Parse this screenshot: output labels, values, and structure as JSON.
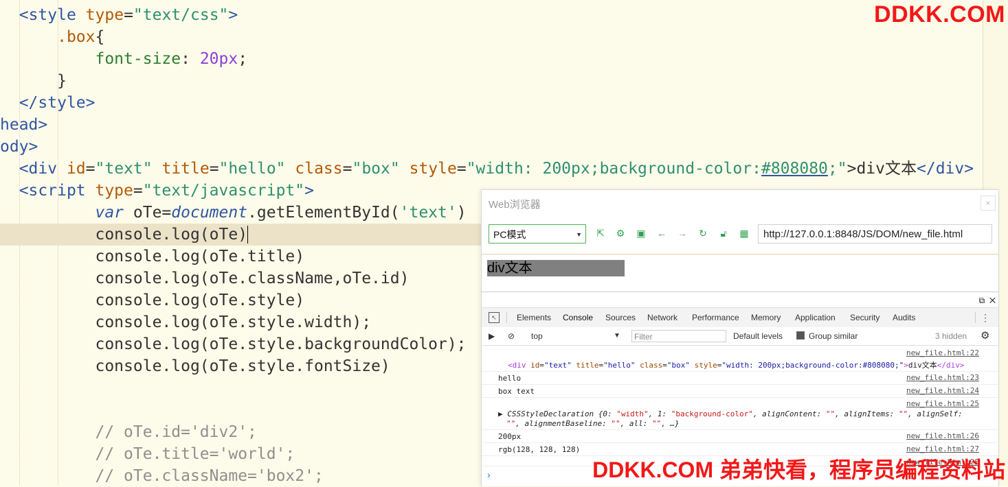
{
  "watermarks": {
    "top": "DDKK.COM",
    "bottom": "DDKK.COM 弟弟快看，程序员编程资料站"
  },
  "code": {
    "l1": {
      "lt": "<",
      "tag": "style",
      "sp": " ",
      "attr": "type",
      "eq": "=",
      "val": "\"text/css\"",
      "gt": ">"
    },
    "l2": {
      "sel": ".box",
      "brace": "{"
    },
    "l3": {
      "prop": "font-size",
      "colon": ": ",
      "num": "20px",
      "semi": ";"
    },
    "l4": {
      "brace": "}"
    },
    "l5": {
      "text": "</style>"
    },
    "l6": {
      "text": "head>"
    },
    "l7": {
      "text": "ody>"
    },
    "l8": {
      "open": "<div ",
      "a1": "id",
      "v1": "\"text\"",
      "a2": "title",
      "v2": "\"hello\"",
      "a3": "class",
      "v3": "\"box\"",
      "a4": "style",
      "v4a": "\"width: 200px;background-color:",
      "v4b": "#808080",
      "v4c": ";\"",
      "content": ">div文本",
      "close": "</div>"
    },
    "l9": {
      "open": "<script ",
      "attr": "type",
      "val": "\"text/javascript\"",
      "gt": ">"
    },
    "l10": {
      "kw": "var",
      "mid": " oTe=",
      "doc": "document",
      "rest": ".getElementById(",
      "str": "'text'",
      "end": ")"
    },
    "l11": "console.log(oTe)",
    "l12": "console.log(oTe.title)",
    "l13": "console.log(oTe.className,oTe.id)",
    "l14": "console.log(oTe.style)",
    "l15": "console.log(oTe.style.width);",
    "l16": "console.log(oTe.style.backgroundColor);",
    "l17": "console.log(oTe.style.fontSize)",
    "c1": "// oTe.id='div2';",
    "c2": "// oTe.title='world';",
    "c3": "// oTe.className='box2';"
  },
  "browser": {
    "title": "Web浏览器",
    "close_icon": "×",
    "mode": "PC模式",
    "url": "http://127.0.0.1:8848/JS/DOM/new_file.html",
    "page_text": "div文本"
  },
  "devtools": {
    "tabs": [
      "Elements",
      "Console",
      "Sources",
      "Network",
      "Performance",
      "Memory",
      "Application",
      "Security",
      "Audits"
    ],
    "active_tab": "Console",
    "context": "top",
    "filter_placeholder": "Filter",
    "levels": "Default levels",
    "group_similar": "Group similar",
    "hidden": "3 hidden",
    "logs": [
      {
        "src": "new_file.html:22"
      },
      {
        "src": "new_file.html:23",
        "text": "hello"
      },
      {
        "src": "new_file.html:24",
        "text": "box text"
      },
      {
        "src": "new_file.html:25"
      },
      {
        "src": "new_file.html:26",
        "text": "200px"
      },
      {
        "src": "new_file.html:27",
        "text": "rgb(128, 128, 128)"
      },
      {
        "src": "new_file.html:28"
      }
    ],
    "elem_log": {
      "open": "<div ",
      "a1": "id",
      "v1": "\"text\"",
      "a2": "title",
      "v2": "\"hello\"",
      "a3": "class",
      "v3": "\"box\"",
      "a4": "style",
      "v4": "\"width: 200px;background-color:#808080;\"",
      "gt": ">",
      "content": "div文本",
      "close": "</div>"
    },
    "obj_log": {
      "line1a": "CSSStyleDeclaration",
      "line1b": " {0: ",
      "s1": "\"width\"",
      "line1c": ", 1: ",
      "s2": "\"background-color\"",
      "line1d": ", alignContent: ",
      "s3": "\"\"",
      "line1e": ", alignItems: ",
      "s4": "\"\"",
      "line1f": ", alignSelf:",
      "line2a": "\"\"",
      "line2b": ", alignmentBaseline: ",
      "s5": "\"\"",
      "line2c": ", all: ",
      "s6": "\"\"",
      "line2d": ", …}"
    }
  }
}
